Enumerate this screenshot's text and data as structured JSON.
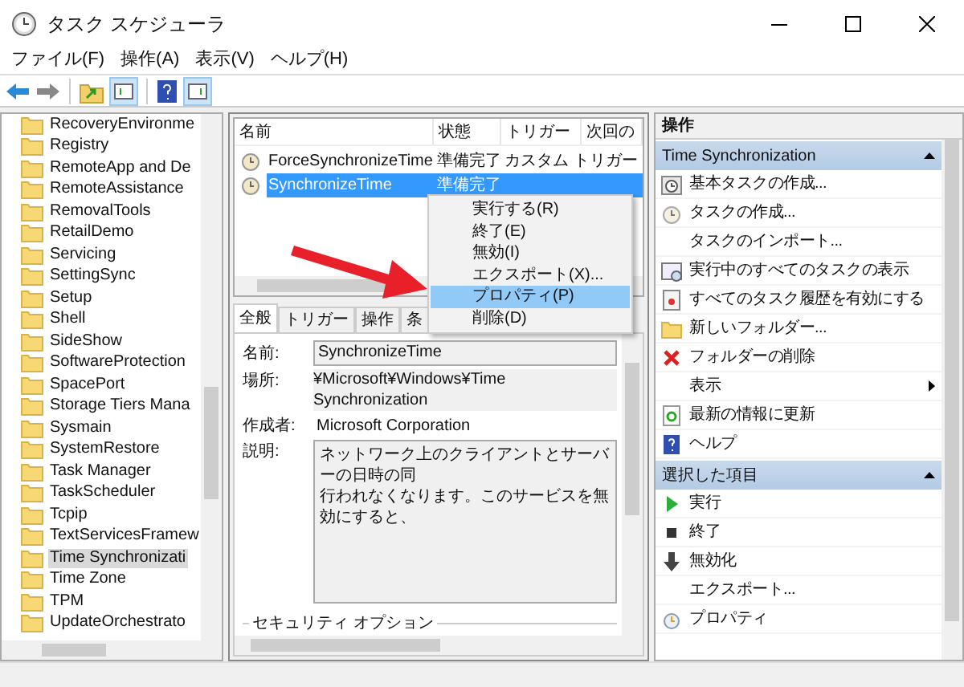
{
  "window": {
    "title": "タスク スケジューラ"
  },
  "menu": [
    "ファイル(F)",
    "操作(A)",
    "表示(V)",
    "ヘルプ(H)"
  ],
  "tree": {
    "items": [
      {
        "label": "RecoveryEnvironme",
        "selected": false
      },
      {
        "label": "Registry",
        "selected": false
      },
      {
        "label": "RemoteApp and De",
        "selected": false
      },
      {
        "label": "RemoteAssistance",
        "selected": false
      },
      {
        "label": "RemovalTools",
        "selected": false
      },
      {
        "label": "RetailDemo",
        "selected": false
      },
      {
        "label": "Servicing",
        "selected": false
      },
      {
        "label": "SettingSync",
        "selected": false
      },
      {
        "label": "Setup",
        "selected": false
      },
      {
        "label": "Shell",
        "selected": false
      },
      {
        "label": "SideShow",
        "selected": false
      },
      {
        "label": "SoftwareProtection",
        "selected": false
      },
      {
        "label": "SpacePort",
        "selected": false
      },
      {
        "label": "Storage Tiers Mana",
        "selected": false
      },
      {
        "label": "Sysmain",
        "selected": false
      },
      {
        "label": "SystemRestore",
        "selected": false
      },
      {
        "label": "Task Manager",
        "selected": false
      },
      {
        "label": "TaskScheduler",
        "selected": false
      },
      {
        "label": "Tcpip",
        "selected": false
      },
      {
        "label": "TextServicesFramew",
        "selected": false
      },
      {
        "label": "Time Synchronizati",
        "selected": true
      },
      {
        "label": "Time Zone",
        "selected": false
      },
      {
        "label": "TPM",
        "selected": false
      },
      {
        "label": "UpdateOrchestrato",
        "selected": false
      }
    ]
  },
  "task_table": {
    "columns": [
      "名前",
      "状態",
      "トリガー",
      "次回の"
    ],
    "rows": [
      {
        "name": "ForceSynchronizeTime",
        "status": "準備完了",
        "trigger": "カスタム トリガー",
        "selected": false
      },
      {
        "name": "SynchronizeTime",
        "status": "準備完了",
        "selected": true
      }
    ]
  },
  "context_menu": [
    {
      "label": "実行する(R)",
      "selected": false
    },
    {
      "label": "終了(E)",
      "selected": false
    },
    {
      "label": "無効(I)",
      "selected": false
    },
    {
      "label": "エクスポート(X)...",
      "selected": false
    },
    {
      "label": "プロパティ(P)",
      "selected": true
    },
    {
      "label": "削除(D)",
      "selected": false
    }
  ],
  "details": {
    "tabs": [
      {
        "label": "全般",
        "selected": true
      },
      {
        "label": "トリガー",
        "selected": false
      },
      {
        "label": "操作",
        "selected": false
      },
      {
        "label": "条",
        "selected": false
      }
    ],
    "name_label": "名前:",
    "name_value": "SynchronizeTime",
    "location_label": "場所:",
    "location_value": "¥Microsoft¥Windows¥Time Synchronization",
    "author_label": "作成者:",
    "author_value": "Microsoft Corporation",
    "description_label": "説明:",
    "description_lines": [
      "ネットワーク上のクライアントとサーバーの日時の同",
      "行われなくなります。このサービスを無効にすると、"
    ],
    "security_label": "セキュリティ オプション"
  },
  "actions": {
    "title": "操作",
    "groups": [
      {
        "title": "Time Synchronization",
        "items": [
          {
            "label": "基本タスクの作成..."
          },
          {
            "label": "タスクの作成..."
          },
          {
            "label": "タスクのインポート..."
          },
          {
            "label": "実行中のすべてのタスクの表示"
          },
          {
            "label": "すべてのタスク履歴を有効にする"
          },
          {
            "label": "新しいフォルダー..."
          },
          {
            "label": "フォルダーの削除"
          },
          {
            "label": "表示",
            "submenu": true
          },
          {
            "label": "最新の情報に更新"
          },
          {
            "label": "ヘルプ"
          }
        ]
      },
      {
        "title": "選択した項目",
        "items": [
          {
            "label": "実行"
          },
          {
            "label": "終了"
          },
          {
            "label": "無効化"
          },
          {
            "label": "エクスポート..."
          },
          {
            "label": "プロパティ"
          }
        ]
      }
    ]
  }
}
